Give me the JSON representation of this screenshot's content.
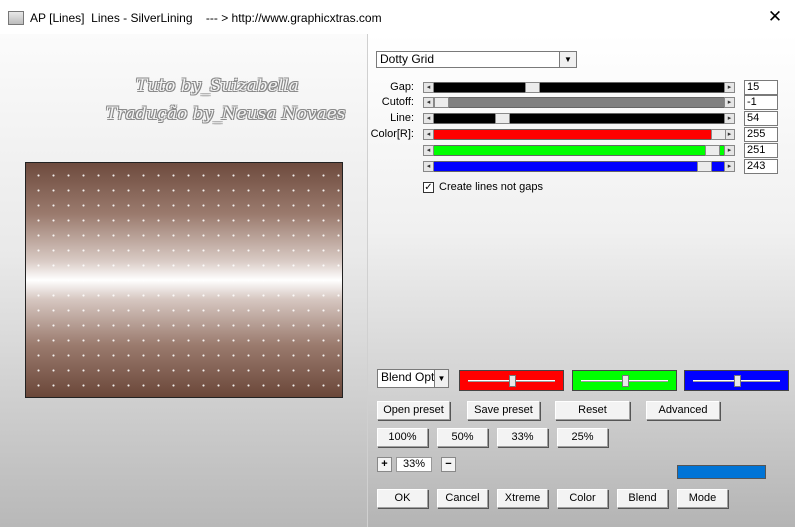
{
  "window": {
    "title": "AP [Lines]  Lines - SilverLining    --- > http://www.graphicxtras.com",
    "close_glyph": "✕"
  },
  "watermark": {
    "line1": "Tuto by_Suizabella",
    "line2": "Tradução by_Neusa Novaes"
  },
  "preset_select": {
    "value": "Dotty Grid"
  },
  "params": [
    {
      "label": "Gap:",
      "value": "15",
      "level": 0.33,
      "track_color": "#000000"
    },
    {
      "label": "Cutoff:",
      "value": "-1",
      "level": 0.0,
      "track_color": "#808080"
    },
    {
      "label": "Line:",
      "value": "54",
      "level": 0.22,
      "track_color": "#000000"
    },
    {
      "label": "Color[R]:",
      "value": "255",
      "level": 1.0,
      "track_color": "#ff0000"
    },
    {
      "label": "",
      "value": "251",
      "level": 0.98,
      "track_color": "#00ff00"
    },
    {
      "label": "",
      "value": "243",
      "level": 0.95,
      "track_color": "#0000ff"
    }
  ],
  "checkbox": {
    "label": "Create lines not gaps",
    "checked": true,
    "mark": "✓"
  },
  "blend_select": {
    "value": "Blend Opti"
  },
  "mini_sliders": [
    {
      "color": "#ff0000",
      "level": 0.5
    },
    {
      "color": "#00ff00",
      "level": 0.5
    },
    {
      "color": "#0000ff",
      "level": 0.5
    }
  ],
  "buttons": {
    "open_preset": "Open preset",
    "save_preset": "Save preset",
    "reset": "Reset",
    "advanced": "Advanced",
    "zoom_100": "100%",
    "zoom_50": "50%",
    "zoom_33": "33%",
    "zoom_25": "25%",
    "ok": "OK",
    "cancel": "Cancel",
    "xtreme": "Xtreme",
    "color": "Color",
    "blend": "Blend",
    "mode": "Mode"
  },
  "zoom": {
    "plus": "+",
    "value": "33%",
    "minus": "−"
  },
  "swatch_color": "#0074d6"
}
